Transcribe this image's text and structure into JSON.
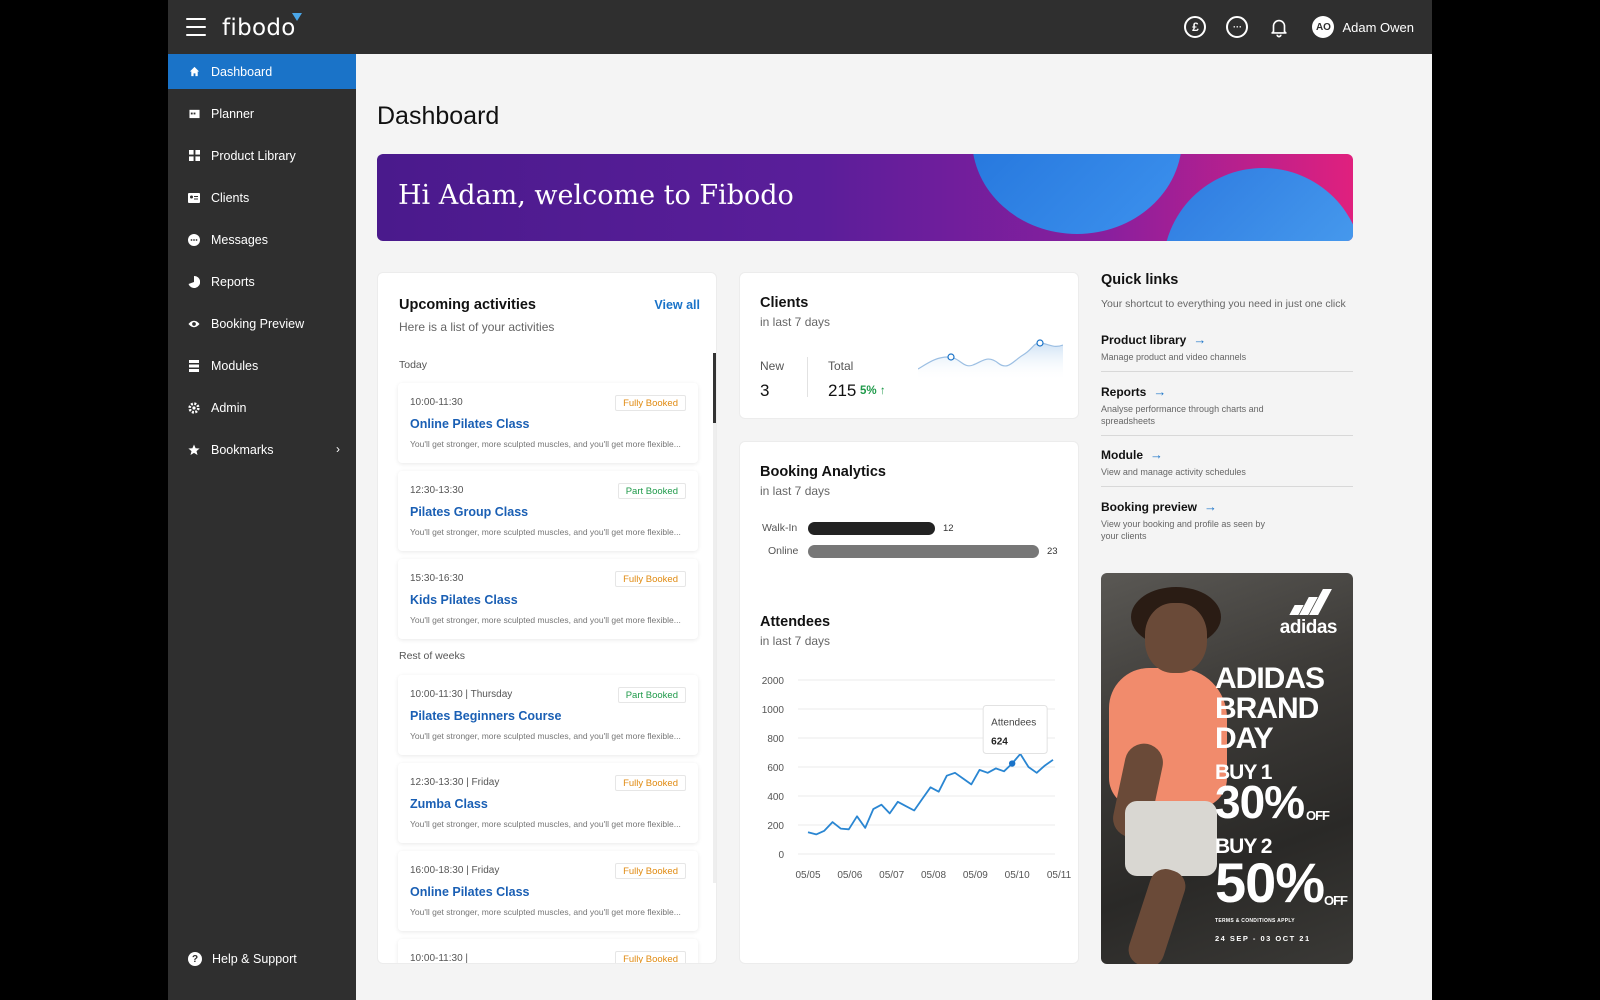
{
  "header": {
    "logo": "fibodo",
    "icons": [
      "pound-icon",
      "chat-icon",
      "bell-icon"
    ],
    "pound_symbol": "£",
    "user_initials": "AO",
    "user_name": "Adam Owen"
  },
  "sidebar": {
    "items": [
      {
        "label": "Dashboard",
        "icon": "home-icon",
        "active": true
      },
      {
        "label": "Planner",
        "icon": "calendar-icon"
      },
      {
        "label": "Product Library",
        "icon": "grid-icon"
      },
      {
        "label": "Clients",
        "icon": "id-card-icon"
      },
      {
        "label": "Messages",
        "icon": "chat-bubble-icon"
      },
      {
        "label": "Reports",
        "icon": "pie-chart-icon"
      },
      {
        "label": "Booking Preview",
        "icon": "eye-icon"
      },
      {
        "label": "Modules",
        "icon": "stack-icon"
      },
      {
        "label": "Admin",
        "icon": "gear-icon"
      },
      {
        "label": "Bookmarks",
        "icon": "star-icon"
      }
    ],
    "help_label": "Help & Support"
  },
  "page_title": "Dashboard",
  "banner": {
    "text": "Hi Adam, welcome to Fibodo"
  },
  "upcoming": {
    "title": "Upcoming activities",
    "subtitle": "Here is a list of your activities",
    "view_all": "View all",
    "today_label": "Today",
    "rest_label": "Rest of weeks",
    "description": "You'll get stronger, more sculpted muscles, and you'll get more flexible...",
    "activities": [
      {
        "time": "10:00-11:30",
        "name": "Online Pilates Class",
        "status": "Fully Booked",
        "kind": "full"
      },
      {
        "time": "12:30-13:30",
        "name": "Pilates Group Class",
        "status": "Part Booked",
        "kind": "part"
      },
      {
        "time": "15:30-16:30",
        "name": "Kids Pilates Class",
        "status": "Fully Booked",
        "kind": "full"
      },
      {
        "time": "10:00-11:30  |  Thursday",
        "name": "Pilates Beginners Course",
        "status": "Part Booked",
        "kind": "part"
      },
      {
        "time": "12:30-13:30  |  Friday",
        "name": "Zumba Class",
        "status": "Fully Booked",
        "kind": "full"
      },
      {
        "time": "16:00-18:30  |  Friday",
        "name": "Online Pilates Class",
        "status": "Fully Booked",
        "kind": "full"
      },
      {
        "time": "10:00-11:30  |",
        "name": "",
        "status": "Fully Booked",
        "kind": "full"
      }
    ]
  },
  "clients": {
    "title": "Clients",
    "subtitle": "in last 7 days",
    "new_label": "New",
    "new_value": "3",
    "total_label": "Total",
    "total_value": "215",
    "change": "5% ↑"
  },
  "booking": {
    "title": "Booking Analytics",
    "subtitle": "in last 7 days",
    "walkin_label": "Walk-In",
    "walkin_value": "12",
    "online_label": "Online",
    "online_value": "23"
  },
  "attendees": {
    "title": "Attendees",
    "subtitle": "in last 7 days",
    "tooltip_label": "Attendees",
    "tooltip_value": "624"
  },
  "chart_data": {
    "type": "line",
    "series": [
      {
        "name": "Attendees",
        "points": [
          [
            "05/05",
            150
          ],
          [
            "05/05",
            135
          ],
          [
            "05/05",
            160
          ],
          [
            "05/05",
            220
          ],
          [
            "05/05",
            175
          ],
          [
            "05/06",
            170
          ],
          [
            "05/06",
            260
          ],
          [
            "05/06",
            180
          ],
          [
            "05/06",
            310
          ],
          [
            "05/06",
            340
          ],
          [
            "05/07",
            280
          ],
          [
            "05/07",
            360
          ],
          [
            "05/07",
            330
          ],
          [
            "05/07",
            300
          ],
          [
            "05/07",
            380
          ],
          [
            "05/08",
            460
          ],
          [
            "05/08",
            430
          ],
          [
            "05/08",
            540
          ],
          [
            "05/08",
            560
          ],
          [
            "05/08",
            520
          ],
          [
            "05/09",
            480
          ],
          [
            "05/09",
            580
          ],
          [
            "05/09",
            560
          ],
          [
            "05/09",
            590
          ],
          [
            "05/09",
            570
          ],
          [
            "05/10",
            624
          ],
          [
            "05/10",
            690
          ],
          [
            "05/10",
            600
          ],
          [
            "05/10",
            560
          ],
          [
            "05/10",
            610
          ],
          [
            "05/11",
            650
          ]
        ]
      }
    ],
    "x_ticks": [
      "05/05",
      "05/06",
      "05/07",
      "05/08",
      "05/09",
      "05/10",
      "05/11"
    ],
    "y_ticks": [
      "0",
      "200",
      "400",
      "600",
      "800",
      "1000",
      "2000"
    ],
    "highlight": {
      "label": "Attendees",
      "value": 624
    }
  },
  "quick_links": {
    "title": "Quick links",
    "subtitle": "Your shortcut to everything you need in just one click",
    "items": [
      {
        "name": "Product library",
        "desc": "Manage product and video channels"
      },
      {
        "name": "Reports",
        "desc": "Analyse performance through charts and spreadsheets"
      },
      {
        "name": "Module",
        "desc": "View and manage activity schedules"
      },
      {
        "name": "Booking preview",
        "desc": "View your booking and profile as seen by your clients"
      }
    ]
  },
  "ad": {
    "brand": "adidas",
    "line1": "ADIDAS",
    "line2": "BRAND",
    "line3": "DAY",
    "buy1": "BUY 1",
    "pct1": "30%",
    "off": "OFF",
    "buy2": "BUY 2",
    "pct2": "50%",
    "terms": "TERMS & CONDITIONS APPLY",
    "dates": "24 SEP - 03 OCT 21"
  },
  "colors": {
    "accent": "#1a73c8",
    "topbar": "#2f2f2f",
    "green": "#1f9a4a",
    "orange": "#e08a10"
  }
}
